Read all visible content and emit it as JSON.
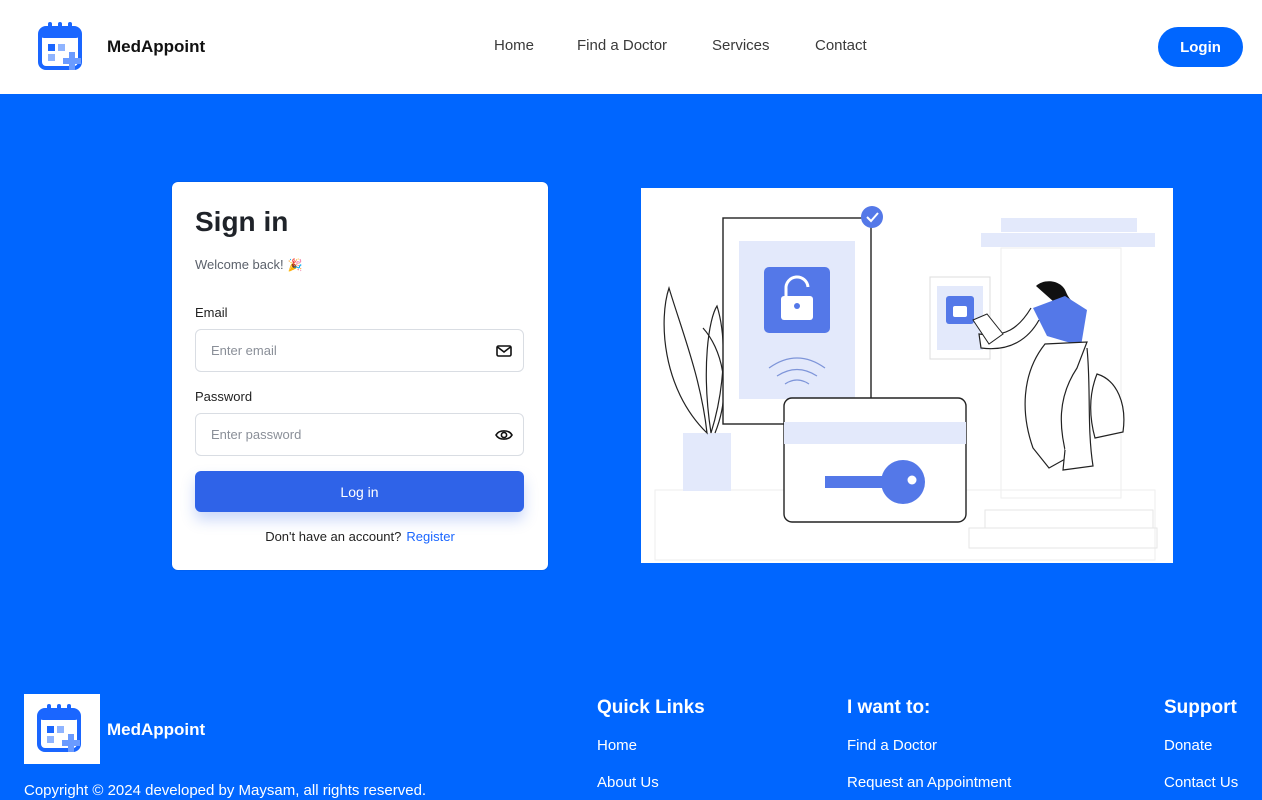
{
  "header": {
    "brand": "MedAppoint",
    "nav": [
      "Home",
      "Find a Doctor",
      "Services",
      "Contact"
    ],
    "login_label": "Login"
  },
  "signin": {
    "title": "Sign in",
    "subtitle": "Welcome back!",
    "subtitle_emoji": "🎉",
    "email_label": "Email",
    "email_placeholder": "Enter email",
    "password_label": "Password",
    "password_placeholder": "Enter password",
    "submit_label": "Log in",
    "register_prompt": "Don't have an account?",
    "register_link": "Register"
  },
  "footer": {
    "brand": "MedAppoint",
    "copyright": "Copyright © 2024 developed by Maysam, all rights reserved.",
    "quick_links": {
      "title": "Quick Links",
      "items": [
        "Home",
        "About Us"
      ]
    },
    "i_want_to": {
      "title": "I want to:",
      "items": [
        "Find a Doctor",
        "Request an Appointment"
      ]
    },
    "support": {
      "title": "Support",
      "items": [
        "Donate",
        "Contact Us"
      ]
    }
  },
  "colors": {
    "primary": "#0066ff",
    "button": "#2f63e8",
    "illustration_accent": "#5478e8",
    "illustration_light": "#e3e9fb"
  },
  "icons": [
    "calendar-plus-icon",
    "mail-icon",
    "eye-icon"
  ]
}
